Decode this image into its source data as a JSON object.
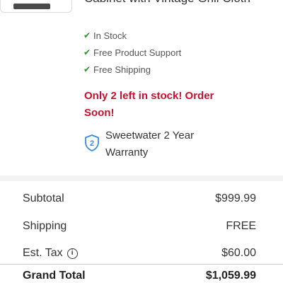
{
  "product": {
    "title": "Cabinet with Vintage Grill Cloth",
    "features": [
      {
        "icon": "checkmark-icon",
        "label": "In Stock"
      },
      {
        "icon": "checkmark-icon",
        "label": "Free Product Support"
      },
      {
        "icon": "checkmark-icon",
        "label": "Free Shipping"
      }
    ],
    "stock_alert": "Only 2 left in stock! Order Soon!",
    "warranty": {
      "icon": "warranty-shield-icon",
      "badge": "2",
      "label": "Sweetwater 2 Year Warranty"
    }
  },
  "summary": {
    "subtotal_label": "Subtotal",
    "subtotal_value": "$999.99",
    "shipping_label": "Shipping",
    "shipping_value": "FREE",
    "tax_label": "Est. Tax",
    "tax_info_icon": "i",
    "tax_value": "$60.00",
    "grand_total_label": "Grand Total",
    "grand_total_value": "$1,059.99"
  },
  "colors": {
    "accent_red": "#c8102e",
    "check_green": "#2f8f2f",
    "warranty_blue": "#3a8bd8"
  }
}
